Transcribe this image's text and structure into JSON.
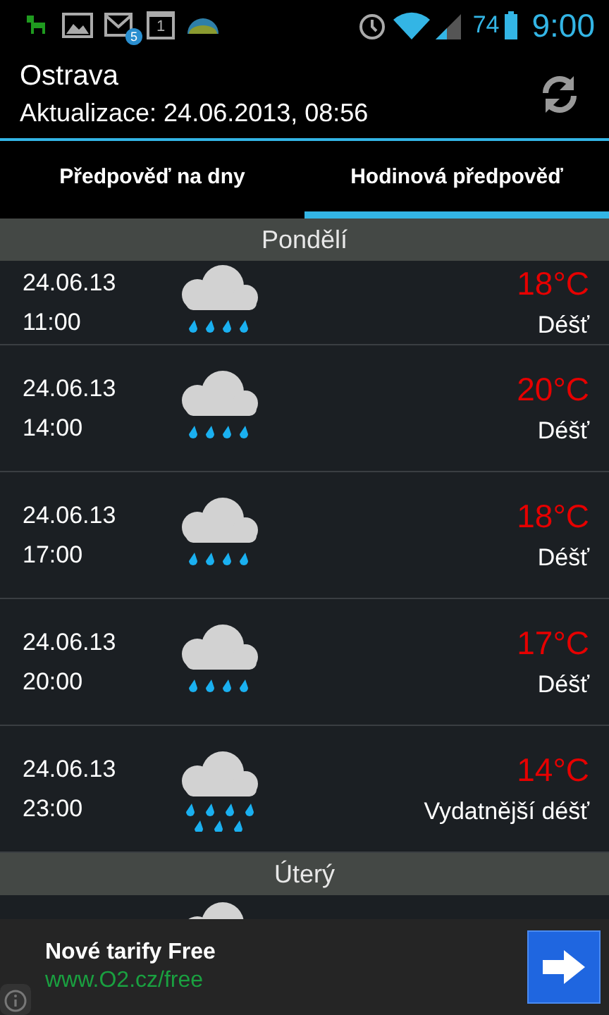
{
  "status_bar": {
    "mail_count": "5",
    "calendar_day": "1",
    "battery": "74",
    "time": "9:00"
  },
  "header": {
    "city": "Ostrava",
    "updated": "Aktualizace: 24.06.2013, 08:56"
  },
  "tabs": [
    {
      "label": "Předpověď na dny",
      "selected": false
    },
    {
      "label": "Hodinová předpověď",
      "selected": true
    }
  ],
  "sections": [
    {
      "day": "Pondělí",
      "rows": [
        {
          "date": "24.06.13",
          "time": "11:00",
          "kind": "rain",
          "temperature": "18°C",
          "condition": "Déšť"
        },
        {
          "date": "24.06.13",
          "time": "14:00",
          "kind": "rain",
          "temperature": "20°C",
          "condition": "Déšť"
        },
        {
          "date": "24.06.13",
          "time": "17:00",
          "kind": "rain",
          "temperature": "18°C",
          "condition": "Déšť"
        },
        {
          "date": "24.06.13",
          "time": "20:00",
          "kind": "rain",
          "temperature": "17°C",
          "condition": "Déšť"
        },
        {
          "date": "24.06.13",
          "time": "23:00",
          "kind": "heavy_rain",
          "temperature": "14°C",
          "condition": "Vydatnější déšť"
        }
      ]
    },
    {
      "day": "Úterý",
      "rows": [
        {
          "kind": "cloud"
        }
      ]
    }
  ],
  "ad": {
    "title": "Nové tarify Free",
    "url": "www.O2.cz/free"
  }
}
